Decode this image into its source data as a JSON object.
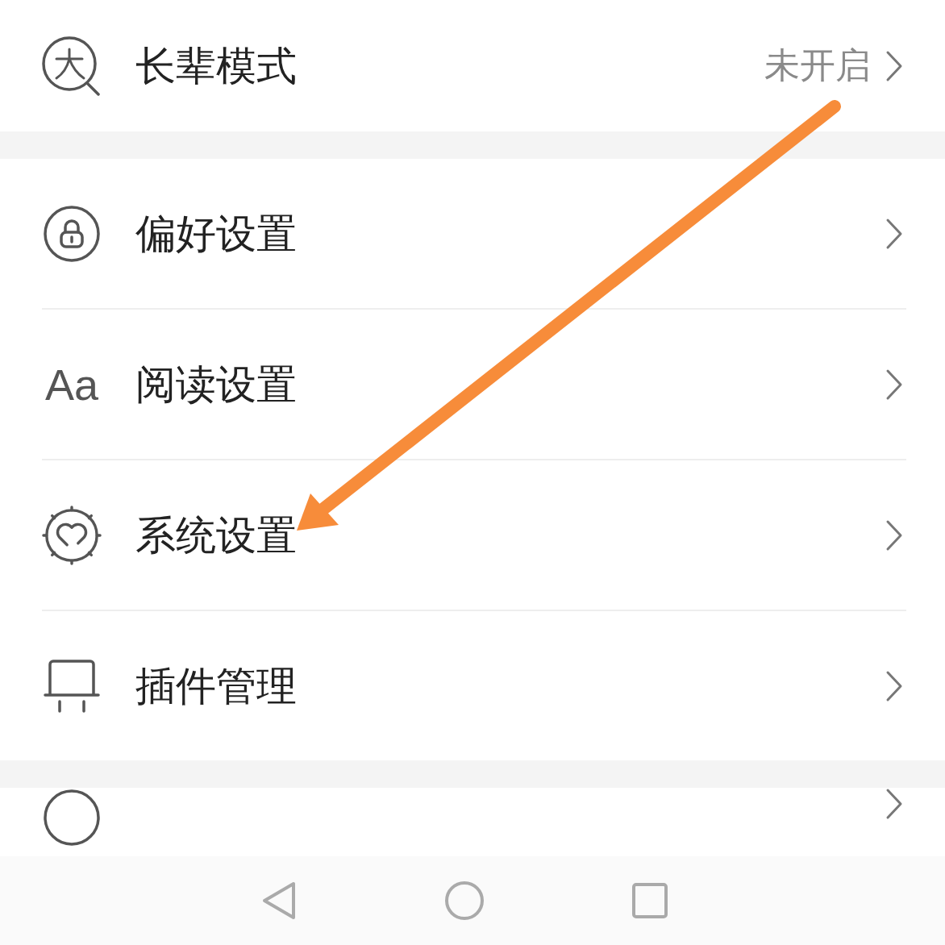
{
  "sections": [
    {
      "items": [
        {
          "kind": "elder",
          "label": "长辈模式",
          "value": "未开启"
        }
      ]
    },
    {
      "items": [
        {
          "kind": "lock",
          "label": "偏好设置"
        },
        {
          "kind": "glyph",
          "glyph": "Aa",
          "label": "阅读设置"
        },
        {
          "kind": "gear-heart",
          "label": "系统设置"
        },
        {
          "kind": "plug",
          "label": "插件管理"
        }
      ]
    },
    {
      "items": [
        {
          "kind": "ring"
        }
      ]
    }
  ],
  "nav_bar": [
    {
      "kind": "back"
    },
    {
      "kind": "home"
    },
    {
      "kind": "recent"
    }
  ],
  "annotation": {
    "kind": "arrow"
  }
}
